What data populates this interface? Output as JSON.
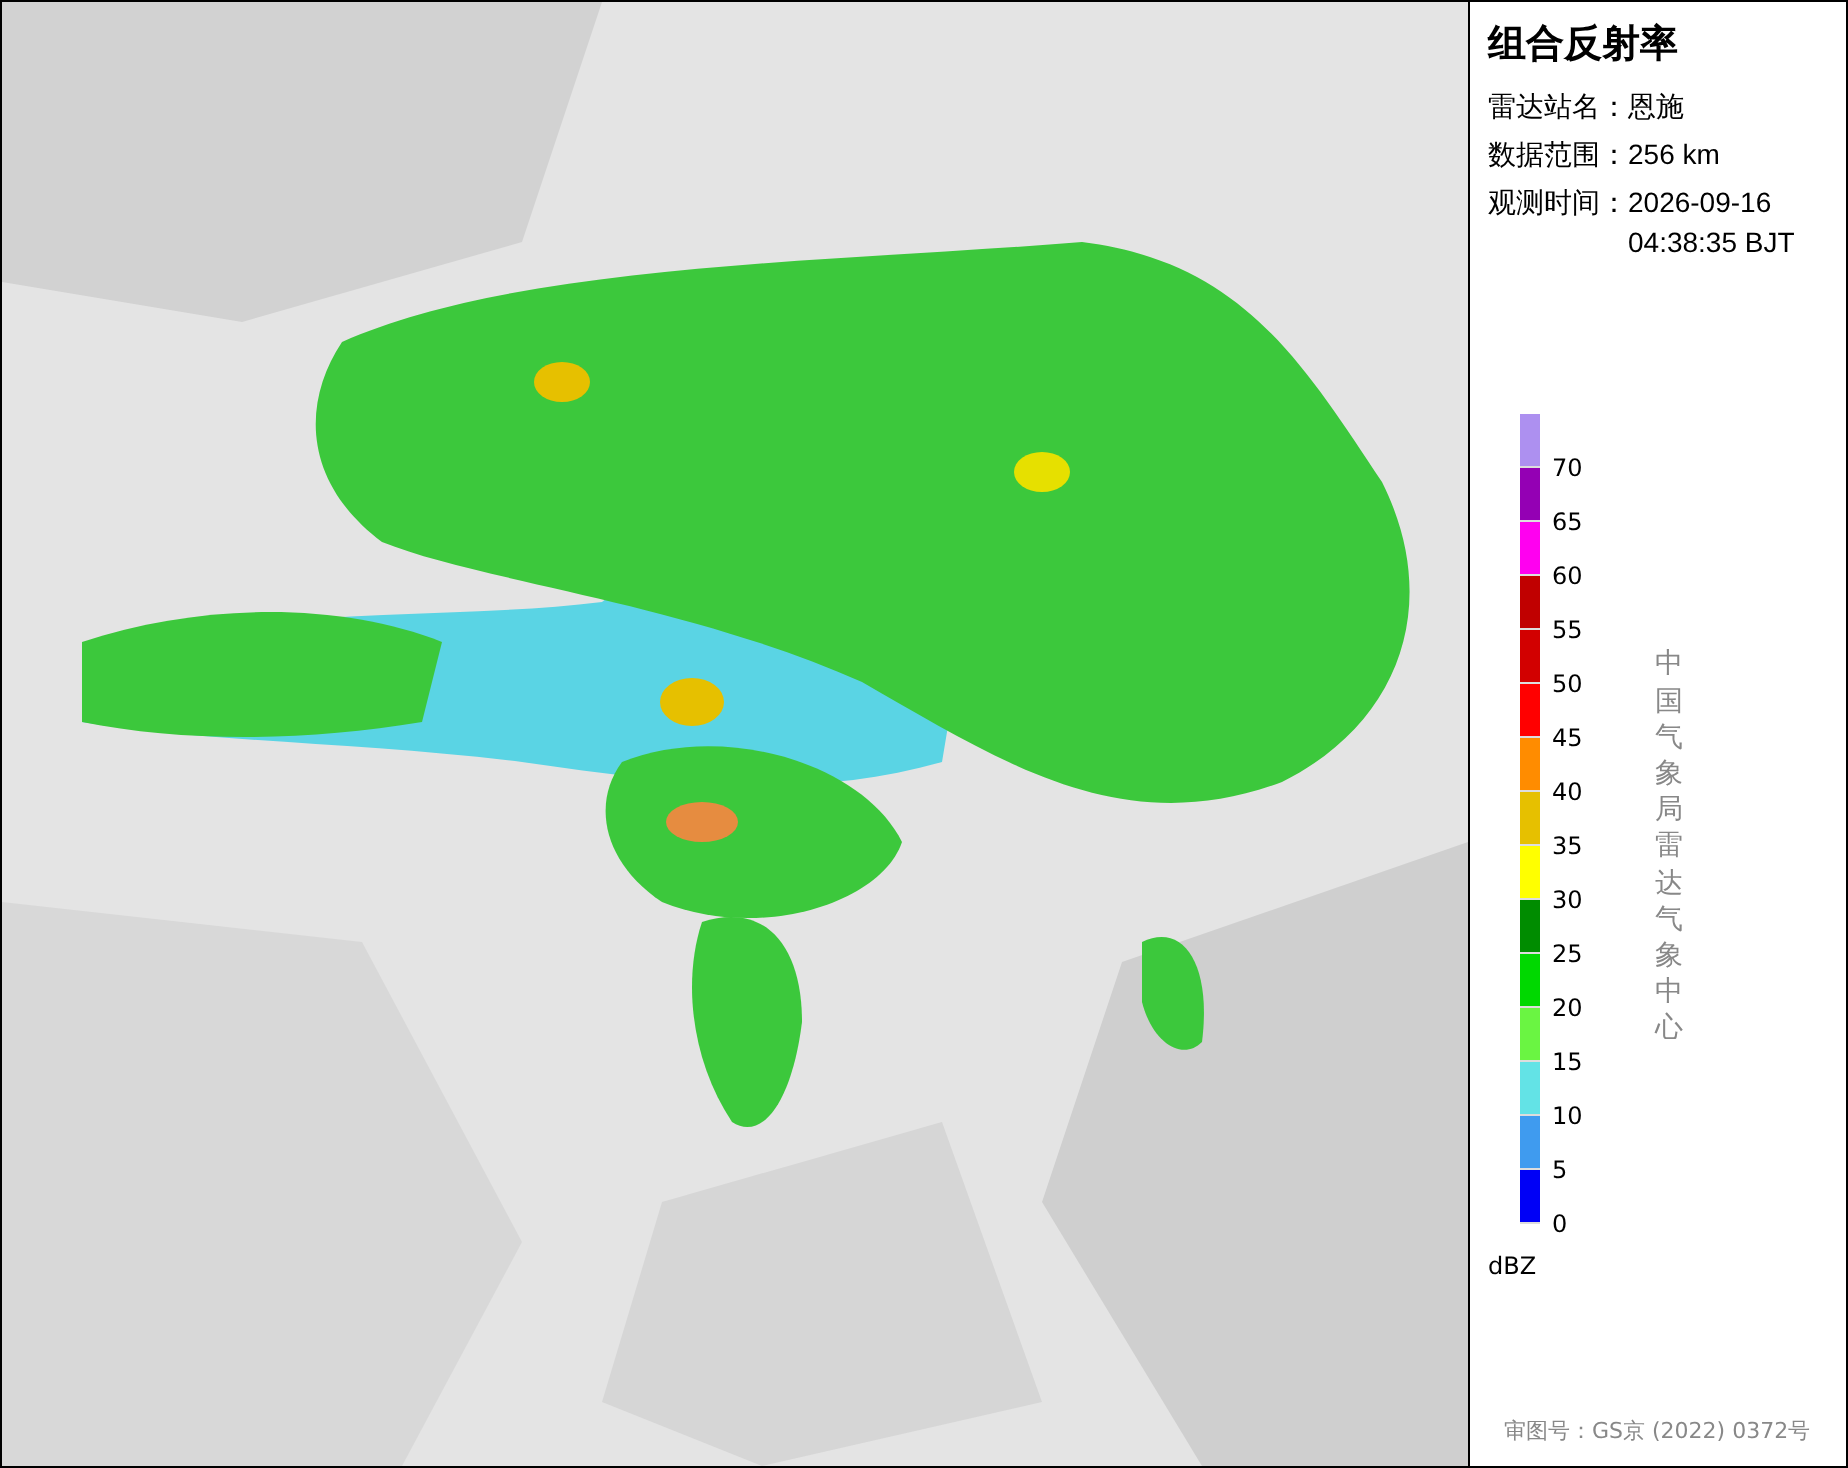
{
  "panel": {
    "title": "组合反射率",
    "fields": [
      {
        "label": "雷达站名：",
        "value": "恩施"
      },
      {
        "label": "数据范围：",
        "value": "256 km"
      },
      {
        "label": "观测时间：",
        "value": "2026-09-16 04:38:35 BJT"
      }
    ],
    "legend": {
      "bins": [
        {
          "label": "70",
          "color": "#ad90f0"
        },
        {
          "label": "65",
          "color": "#9400b4"
        },
        {
          "label": "60",
          "color": "#ff00f0"
        },
        {
          "label": "55",
          "color": "#c00000"
        },
        {
          "label": "50",
          "color": "#d20000"
        },
        {
          "label": "45",
          "color": "#ff0000"
        },
        {
          "label": "40",
          "color": "#ff8c00"
        },
        {
          "label": "35",
          "color": "#e6c000"
        },
        {
          "label": "30",
          "color": "#ffff00"
        },
        {
          "label": "25",
          "color": "#008c00"
        },
        {
          "label": "20",
          "color": "#00d800"
        },
        {
          "label": "15",
          "color": "#6af542"
        },
        {
          "label": "10",
          "color": "#63e3e6"
        },
        {
          "label": "5",
          "color": "#3f9bef"
        },
        {
          "label": "0",
          "color": "#0000f6"
        }
      ],
      "unit": "dBZ"
    },
    "credit": "中国气象局雷达气象中心",
    "footer": "审图号：GS京 (2022) 0372号"
  }
}
